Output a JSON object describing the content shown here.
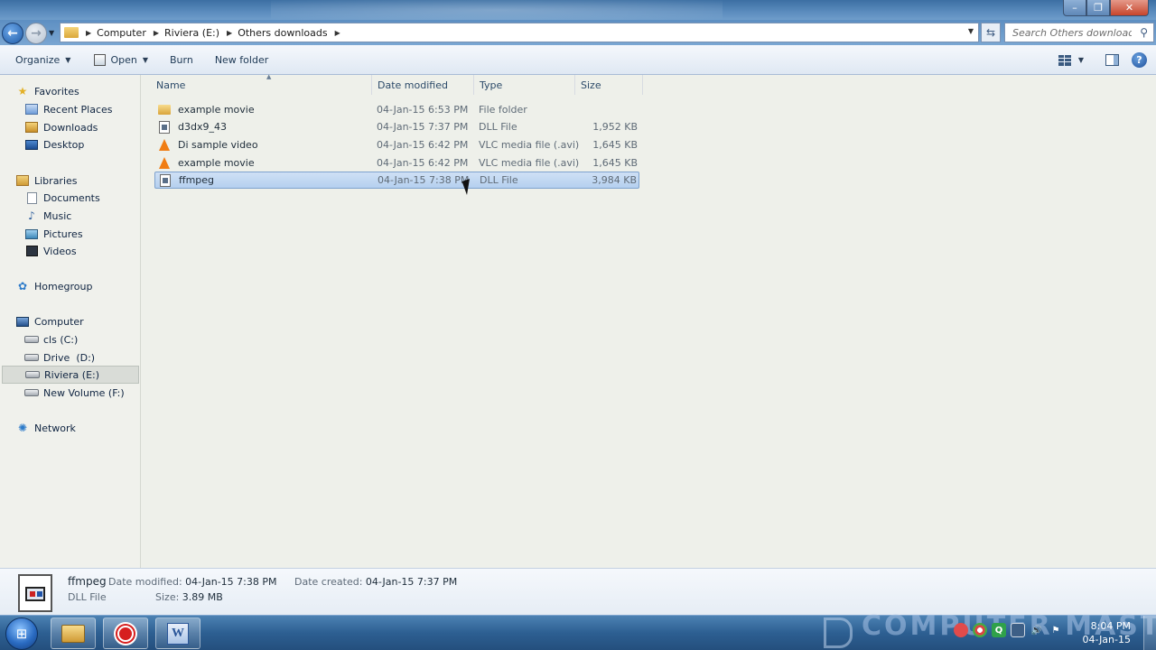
{
  "window": {
    "minimize_glyph": "–",
    "maximize_glyph": "❐",
    "close_glyph": "✕"
  },
  "address": {
    "crumbs": [
      "Computer",
      "Riviera (E:)",
      "Others downloads"
    ],
    "search_placeholder": "Search Others downloads"
  },
  "toolbar": {
    "organize": "Organize",
    "open": "Open",
    "burn": "Burn",
    "new_folder": "New folder"
  },
  "nav": {
    "favorites": "Favorites",
    "recent_places": "Recent Places",
    "downloads": "Downloads",
    "desktop": "Desktop",
    "libraries": "Libraries",
    "documents": "Documents",
    "music": "Music",
    "pictures": "Pictures",
    "videos": "Videos",
    "homegroup": "Homegroup",
    "computer": "Computer",
    "drive_c": "cls (C:)",
    "drive_d": "Drive  (D:)",
    "drive_e": "Riviera (E:)",
    "drive_f": "New Volume (F:)",
    "network": "Network"
  },
  "columns": {
    "name": "Name",
    "date": "Date modified",
    "type": "Type",
    "size": "Size"
  },
  "files": [
    {
      "name": "example movie",
      "date": "04-Jan-15 6:53 PM",
      "type": "File folder",
      "size": "",
      "icon": "folder-icon"
    },
    {
      "name": "d3dx9_43",
      "date": "04-Jan-15 7:37 PM",
      "type": "DLL File",
      "size": "1,952 KB",
      "icon": "dll-file-icon"
    },
    {
      "name": "Di sample video",
      "date": "04-Jan-15 6:42 PM",
      "type": "VLC media file (.avi)",
      "size": "1,645 KB",
      "icon": "vlc-icon"
    },
    {
      "name": "example movie",
      "date": "04-Jan-15 6:42 PM",
      "type": "VLC media file (.avi)",
      "size": "1,645 KB",
      "icon": "vlc-icon"
    },
    {
      "name": "ffmpeg",
      "date": "04-Jan-15 7:38 PM",
      "type": "DLL File",
      "size": "3,984 KB",
      "icon": "dll-file-icon",
      "selected": true
    }
  ],
  "details": {
    "name": "ffmpeg",
    "type": "DLL File",
    "modified_label": "Date modified:",
    "modified_value": "04-Jan-15 7:38 PM",
    "size_label": "Size:",
    "size_value": "3.89 MB",
    "created_label": "Date created:",
    "created_value": "04-Jan-15 7:37 PM"
  },
  "taskbar": {
    "watermark": "COMPUTER MASTER",
    "time": "8:04 PM",
    "date": "04-Jan-15"
  },
  "colors": {
    "selection": "#b5d0ef",
    "taskbar": "#2d5f92",
    "titlebar": "#5b8cbe"
  }
}
